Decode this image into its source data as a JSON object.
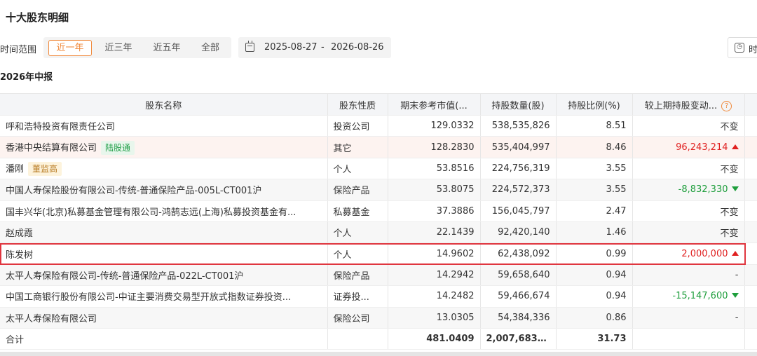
{
  "page_title": "十大股东明细",
  "filter": {
    "label": "时间范围",
    "options": [
      "近一年",
      "近三年",
      "近五年",
      "全部"
    ],
    "active": "近一年",
    "date_start": "2025-08-27",
    "date_sep": "-",
    "date_end": "2026-08-26",
    "right_button_label": "时"
  },
  "report_title": "2026年中报",
  "table": {
    "columns": [
      "股东名称",
      "股东性质",
      "期末参考市值(...",
      "持股数量(股)",
      "持股比例(%)",
      "较上期持股变动..."
    ],
    "rows": [
      {
        "name": "呼和浩特投资有限责任公司",
        "tag": "",
        "type": "投资公司",
        "value": "129.0332",
        "shares": "538,535,826",
        "ratio": "8.51",
        "change": "不变",
        "dir": "none"
      },
      {
        "name": "香港中央结算有限公司",
        "tag": "陆股通",
        "type": "其它",
        "value": "128.2830",
        "shares": "535,404,997",
        "ratio": "8.46",
        "change": "96,243,214",
        "dir": "up"
      },
      {
        "name": "潘刚",
        "tag": "董监高",
        "type": "个人",
        "value": "53.8516",
        "shares": "224,756,319",
        "ratio": "3.55",
        "change": "不变",
        "dir": "none"
      },
      {
        "name": "中国人寿保险股份有限公司-传统-普通保险产品-005L-CT001沪",
        "tag": "",
        "type": "保险产品",
        "value": "53.8075",
        "shares": "224,572,373",
        "ratio": "3.55",
        "change": "-8,832,330",
        "dir": "down"
      },
      {
        "name": "国丰兴华(北京)私募基金管理有限公司-鸿鹄志远(上海)私募投资基金有...",
        "tag": "",
        "type": "私募基金",
        "value": "37.3886",
        "shares": "156,045,797",
        "ratio": "2.47",
        "change": "不变",
        "dir": "none"
      },
      {
        "name": "赵成霞",
        "tag": "",
        "type": "个人",
        "value": "22.1439",
        "shares": "92,420,140",
        "ratio": "1.46",
        "change": "不变",
        "dir": "none"
      },
      {
        "name": "陈发树",
        "tag": "",
        "type": "个人",
        "value": "14.9602",
        "shares": "62,438,092",
        "ratio": "0.99",
        "change": "2,000,000",
        "dir": "up"
      },
      {
        "name": "太平人寿保险有限公司-传统-普通保险产品-022L-CT001沪",
        "tag": "",
        "type": "保险产品",
        "value": "14.2942",
        "shares": "59,658,640",
        "ratio": "0.94",
        "change": "-",
        "dir": "none"
      },
      {
        "name": "中国工商银行股份有限公司-中证主要消费交易型开放式指数证券投资...",
        "tag": "",
        "type": "证券投...",
        "value": "14.2482",
        "shares": "59,466,674",
        "ratio": "0.94",
        "change": "-15,147,600",
        "dir": "down"
      },
      {
        "name": "太平人寿保险有限公司",
        "tag": "",
        "type": "保险公司",
        "value": "13.0305",
        "shares": "54,384,336",
        "ratio": "0.86",
        "change": "-",
        "dir": "none"
      }
    ],
    "total": {
      "label": "合计",
      "value": "481.0409",
      "shares": "2,007,683,1...",
      "ratio": "31.73"
    }
  },
  "colors": {
    "accent": "#f08a3c",
    "up": "#e02020",
    "down": "#1e9e3c",
    "highlight": "#e0363f"
  }
}
